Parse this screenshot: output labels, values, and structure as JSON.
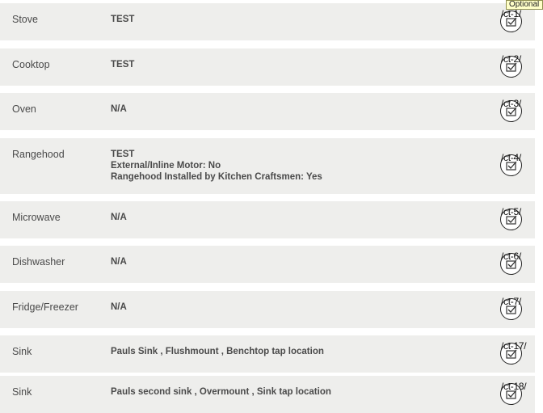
{
  "rows": [
    {
      "label": "Stove",
      "values": [
        "TEST"
      ],
      "code": "/ct-1/"
    },
    {
      "label": "Cooktop",
      "values": [
        "TEST"
      ],
      "code": "/ct-2/"
    },
    {
      "label": "Oven",
      "values": [
        "N/A"
      ],
      "code": "/ct-3/"
    },
    {
      "label": "Rangehood",
      "values": [
        "TEST",
        "External/Inline Motor: No",
        "Rangehood Installed by Kitchen Craftsmen: Yes"
      ],
      "code": "/ct-4/"
    },
    {
      "label": "Microwave",
      "values": [
        "N/A"
      ],
      "code": "/ct-5/"
    },
    {
      "label": "Dishwasher",
      "values": [
        "N/A"
      ],
      "code": "/ct-6/"
    },
    {
      "label": "Fridge/Freezer",
      "values": [
        "N/A"
      ],
      "code": "/ct-7/"
    },
    {
      "label": "Sink",
      "values": [
        "Pauls Sink , Flushmount , Benchtop tap location"
      ],
      "code": "/ct-17/"
    },
    {
      "label": "Sink",
      "values": [
        "Pauls second sink , Overmount , Sink tap location"
      ],
      "code": "/ct-18/"
    }
  ],
  "tooltip": "Optional",
  "colors": {
    "row_background": "#eeeeec",
    "text": "#4a4a4a",
    "tooltip_background": "#ffffc8"
  },
  "icons": {
    "row_action": "check-box-icon"
  }
}
